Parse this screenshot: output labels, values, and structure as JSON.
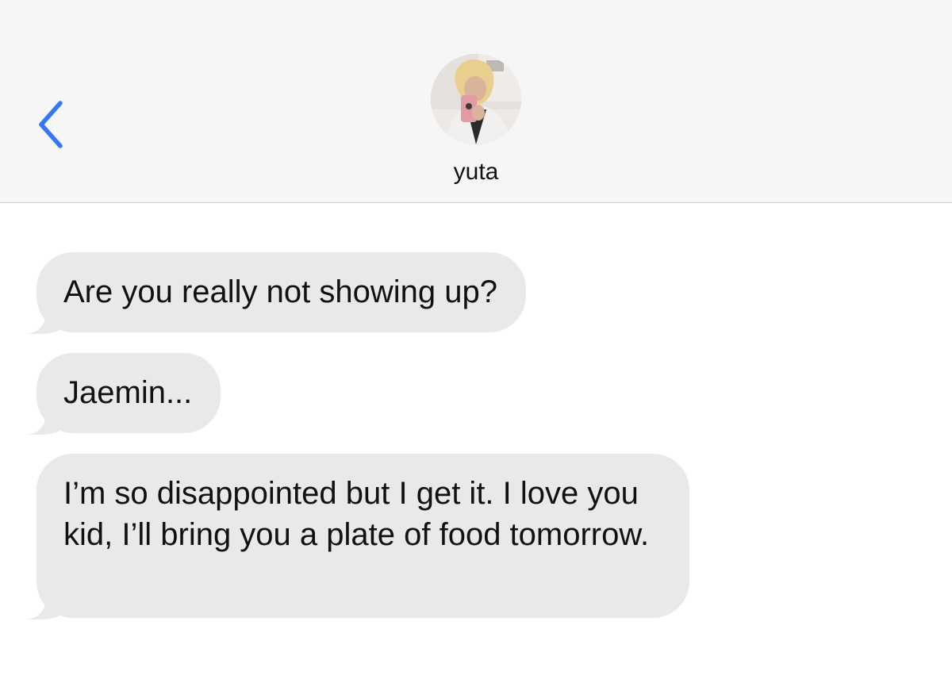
{
  "header": {
    "contact_name": "yuta",
    "back_icon": "chevron-left-icon",
    "accent_color": "#3478f6"
  },
  "messages": [
    {
      "direction": "incoming",
      "text": "Are you really not showing up?"
    },
    {
      "direction": "incoming",
      "text": "Jaemin..."
    },
    {
      "direction": "incoming",
      "text": "I’m so disappointed but I get it. I love you kid, I’ll bring you a plate of food tomorrow."
    }
  ],
  "colors": {
    "header_bg": "#f6f6f7",
    "incoming_bubble": "#e9e9eb",
    "background": "#ffffff"
  }
}
